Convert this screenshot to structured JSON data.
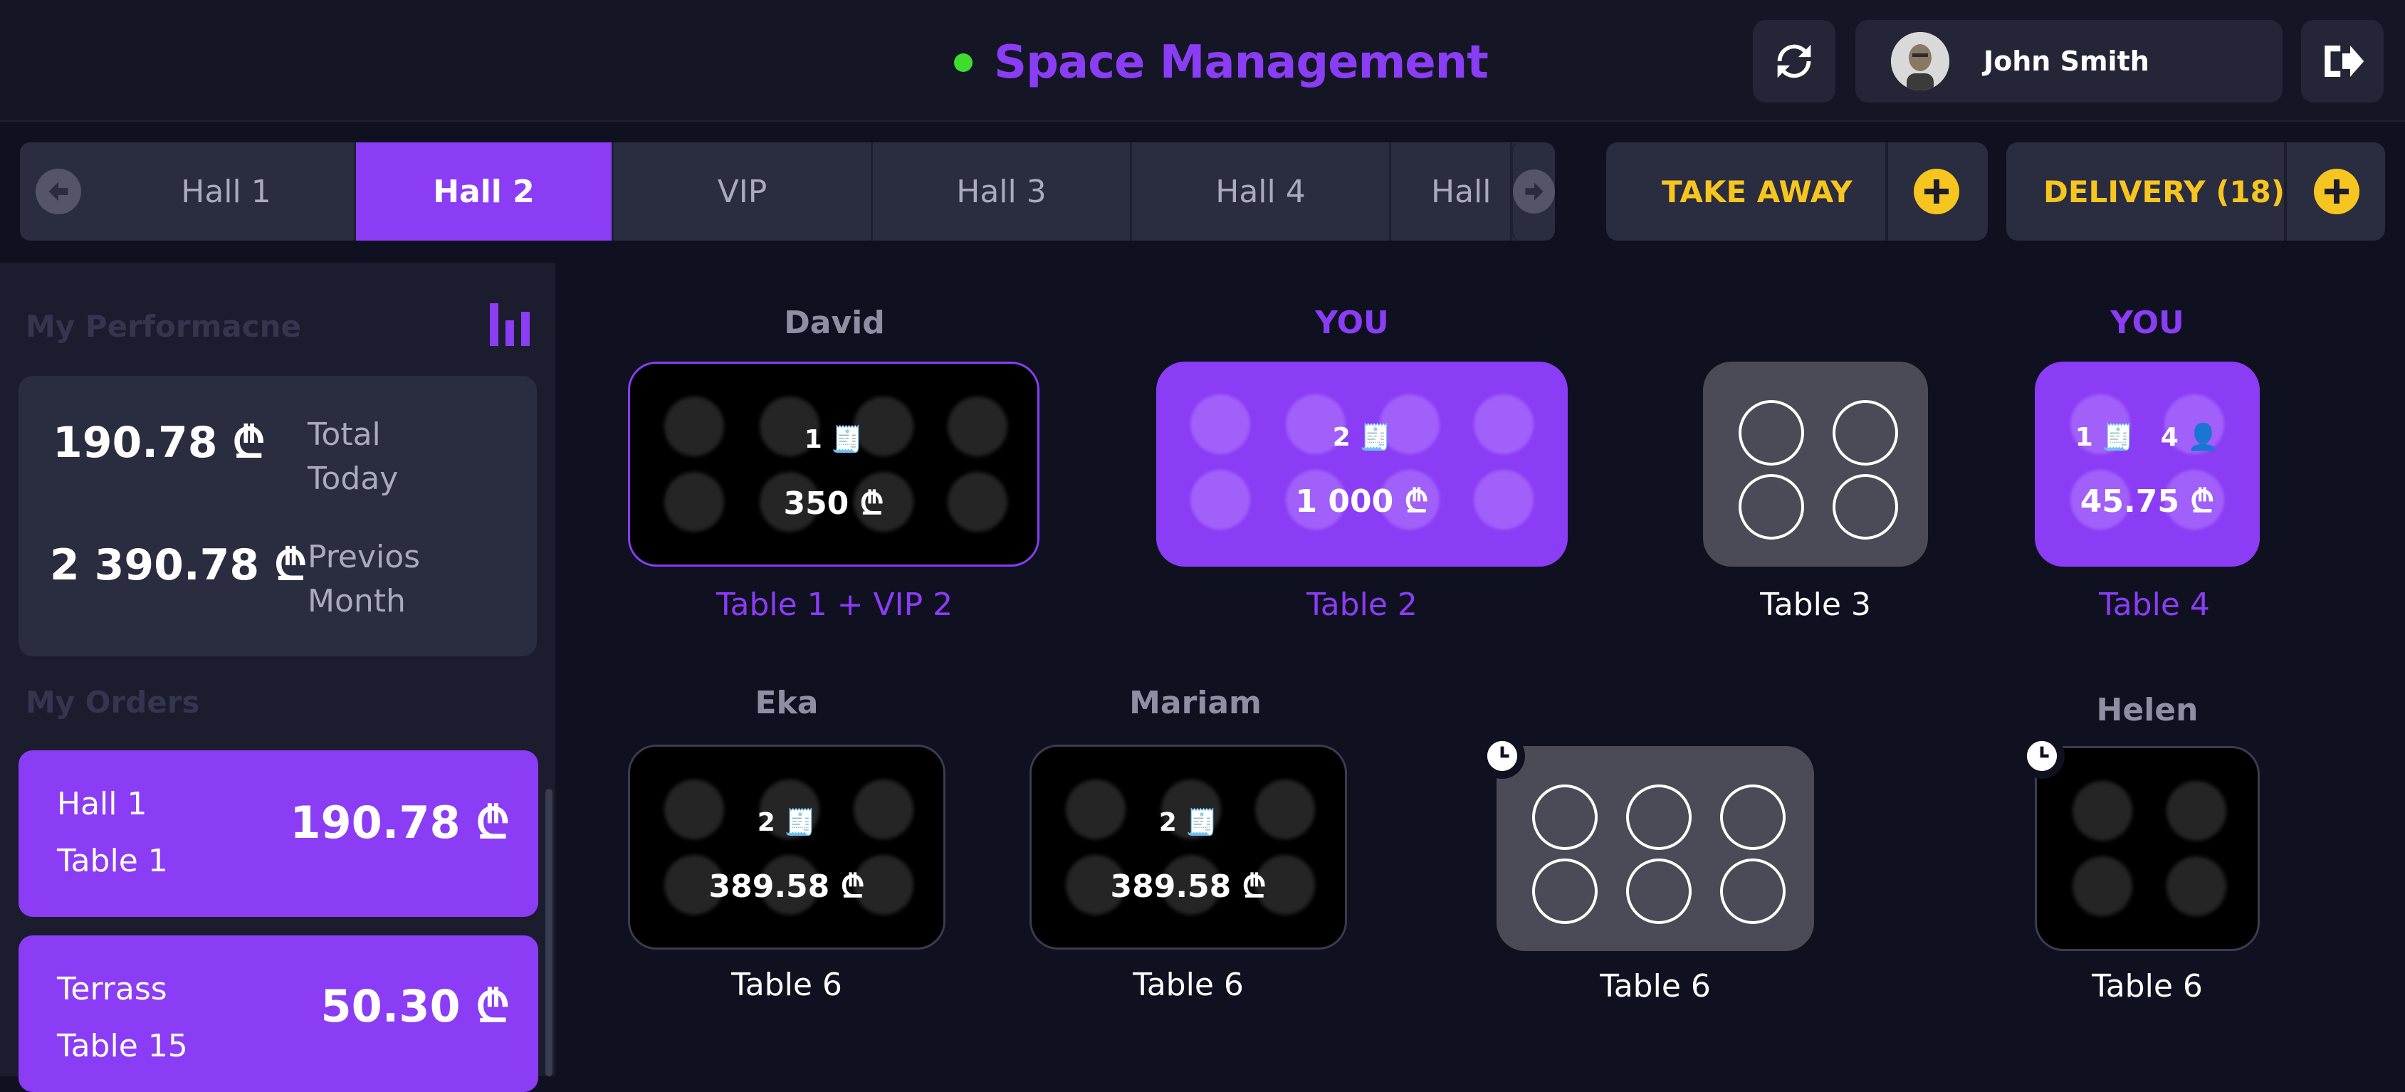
{
  "header": {
    "title": "Space Management",
    "status_color": "#3ddc2e",
    "user": {
      "name": "John Smith",
      "avatar": "avatar-photo"
    },
    "icons": {
      "refresh": "refresh-icon",
      "logout": "logout-icon"
    }
  },
  "tabs": {
    "items": [
      "Hall 1",
      "Hall 2",
      "VIP",
      "Hall 3",
      "Hall 4",
      "Hall"
    ],
    "active": "Hall 2",
    "take_away_label": "TAKE AWAY",
    "delivery_label": "DELIVERY (18)"
  },
  "sidebar": {
    "performance_title": "My Performacne",
    "stats": [
      {
        "value": "190.78 ₾",
        "label_line1": "Total",
        "label_line2": "Today"
      },
      {
        "value": "2 390.78 ₾",
        "label_line1": "Previos",
        "label_line2": "Month"
      }
    ],
    "orders_title": "My Orders",
    "orders": [
      {
        "hall": "Hall 1",
        "table": "Table 1",
        "amount": "190.78 ₾"
      },
      {
        "hall": "Terrass",
        "table": "Table 15",
        "amount": "50.30 ₾"
      }
    ]
  },
  "tables": [
    {
      "waiter": "David",
      "receipts": "1",
      "guests": "",
      "amount": "350 ₾",
      "label": "Table 1 + VIP 2"
    },
    {
      "waiter": "YOU",
      "receipts": "2",
      "guests": "",
      "amount": "1 000 ₾",
      "label": "Table 2"
    },
    {
      "waiter": "",
      "receipts": "",
      "guests": "",
      "amount": "",
      "label": "Table 3"
    },
    {
      "waiter": "YOU",
      "receipts": "1",
      "guests": "4",
      "amount": "45.75 ₾",
      "label": "Table 4"
    },
    {
      "waiter": "Eka",
      "receipts": "2",
      "guests": "",
      "amount": "389.58 ₾",
      "label": "Table 6"
    },
    {
      "waiter": "Mariam",
      "receipts": "2",
      "guests": "",
      "amount": "389.58 ₾",
      "label": "Table 6"
    },
    {
      "waiter": "",
      "receipts": "",
      "guests": "",
      "amount": "",
      "label": "Table 6"
    },
    {
      "waiter": "Helen",
      "receipts": "",
      "guests": "",
      "amount": "",
      "label": "Table 6"
    }
  ],
  "colors": {
    "accent": "#8b3cf5",
    "yellow": "#f7c51f",
    "background": "#0f1120"
  }
}
